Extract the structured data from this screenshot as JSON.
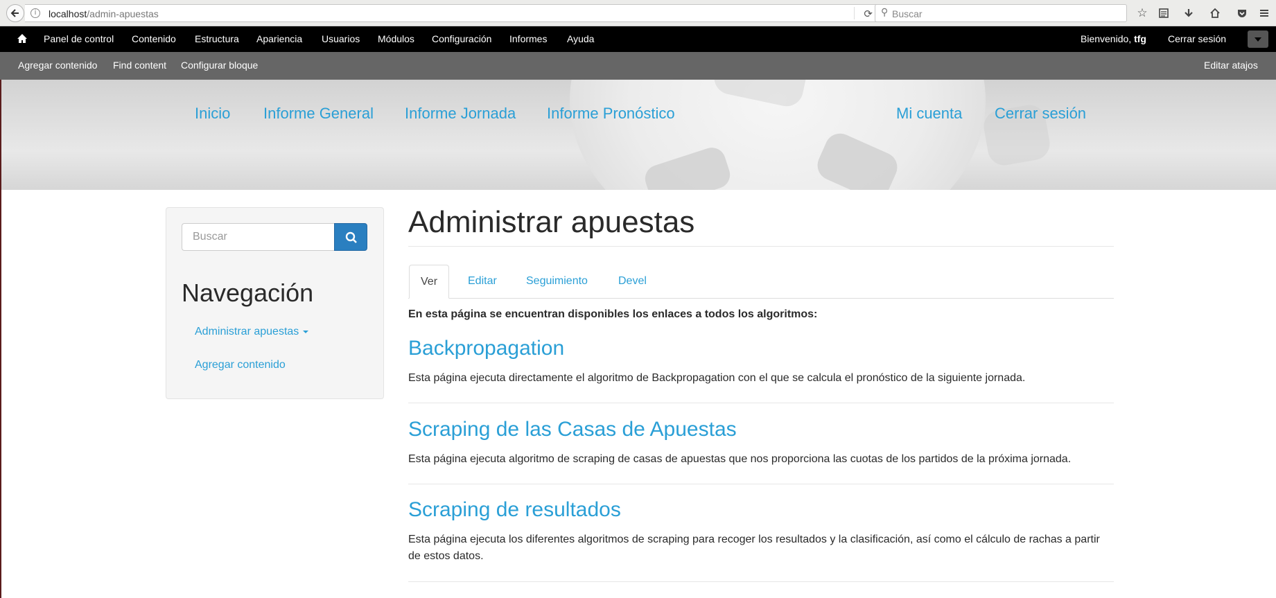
{
  "browser": {
    "url_host": "localhost",
    "url_path": "/admin-apuestas",
    "search_placeholder": "Buscar"
  },
  "toolbar": {
    "items": [
      "Panel de control",
      "Contenido",
      "Estructura",
      "Apariencia",
      "Usuarios",
      "Módulos",
      "Configuración",
      "Informes",
      "Ayuda"
    ],
    "welcome_prefix": "Bienvenido,",
    "username": "tfg",
    "logout": "Cerrar sesión"
  },
  "shortcuts": {
    "items": [
      "Agregar contenido",
      "Find content",
      "Configurar bloque"
    ],
    "edit": "Editar atajos"
  },
  "header_nav": {
    "left": [
      "Inicio",
      "Informe General",
      "Informe Jornada",
      "Informe Pronóstico"
    ],
    "right": [
      "Mi cuenta",
      "Cerrar sesión"
    ]
  },
  "sidebar": {
    "search_placeholder": "Buscar",
    "title": "Navegación",
    "links": [
      "Administrar apuestas",
      "Agregar contenido"
    ]
  },
  "main": {
    "title": "Administrar apuestas",
    "tabs": [
      "Ver",
      "Editar",
      "Seguimiento",
      "Devel"
    ],
    "active_tab": "Ver",
    "intro": "En esta página se encuentran disponibles los enlaces a todos los algoritmos:",
    "items": [
      {
        "title": "Backpropagation",
        "description": "Esta página ejecuta directamente el algoritmo de Backpropagation con el que se calcula el pronóstico de la siguiente jornada."
      },
      {
        "title": "Scraping de las Casas de Apuestas",
        "description": "Esta página ejecuta algoritmo de scraping de casas de apuestas que nos proporciona las cuotas de los partidos de la próxima jornada."
      },
      {
        "title": "Scraping de resultados",
        "description": "Esta página ejecuta los diferentes algoritmos de scraping para recoger los resultados y la clasificación, así como el cálculo de rachas a partir de estos datos."
      }
    ]
  },
  "colors": {
    "link": "#2a9fd6",
    "toolbar_bg": "#000000",
    "shortcuts_bg": "#666666",
    "search_button": "#2a7fc0"
  }
}
